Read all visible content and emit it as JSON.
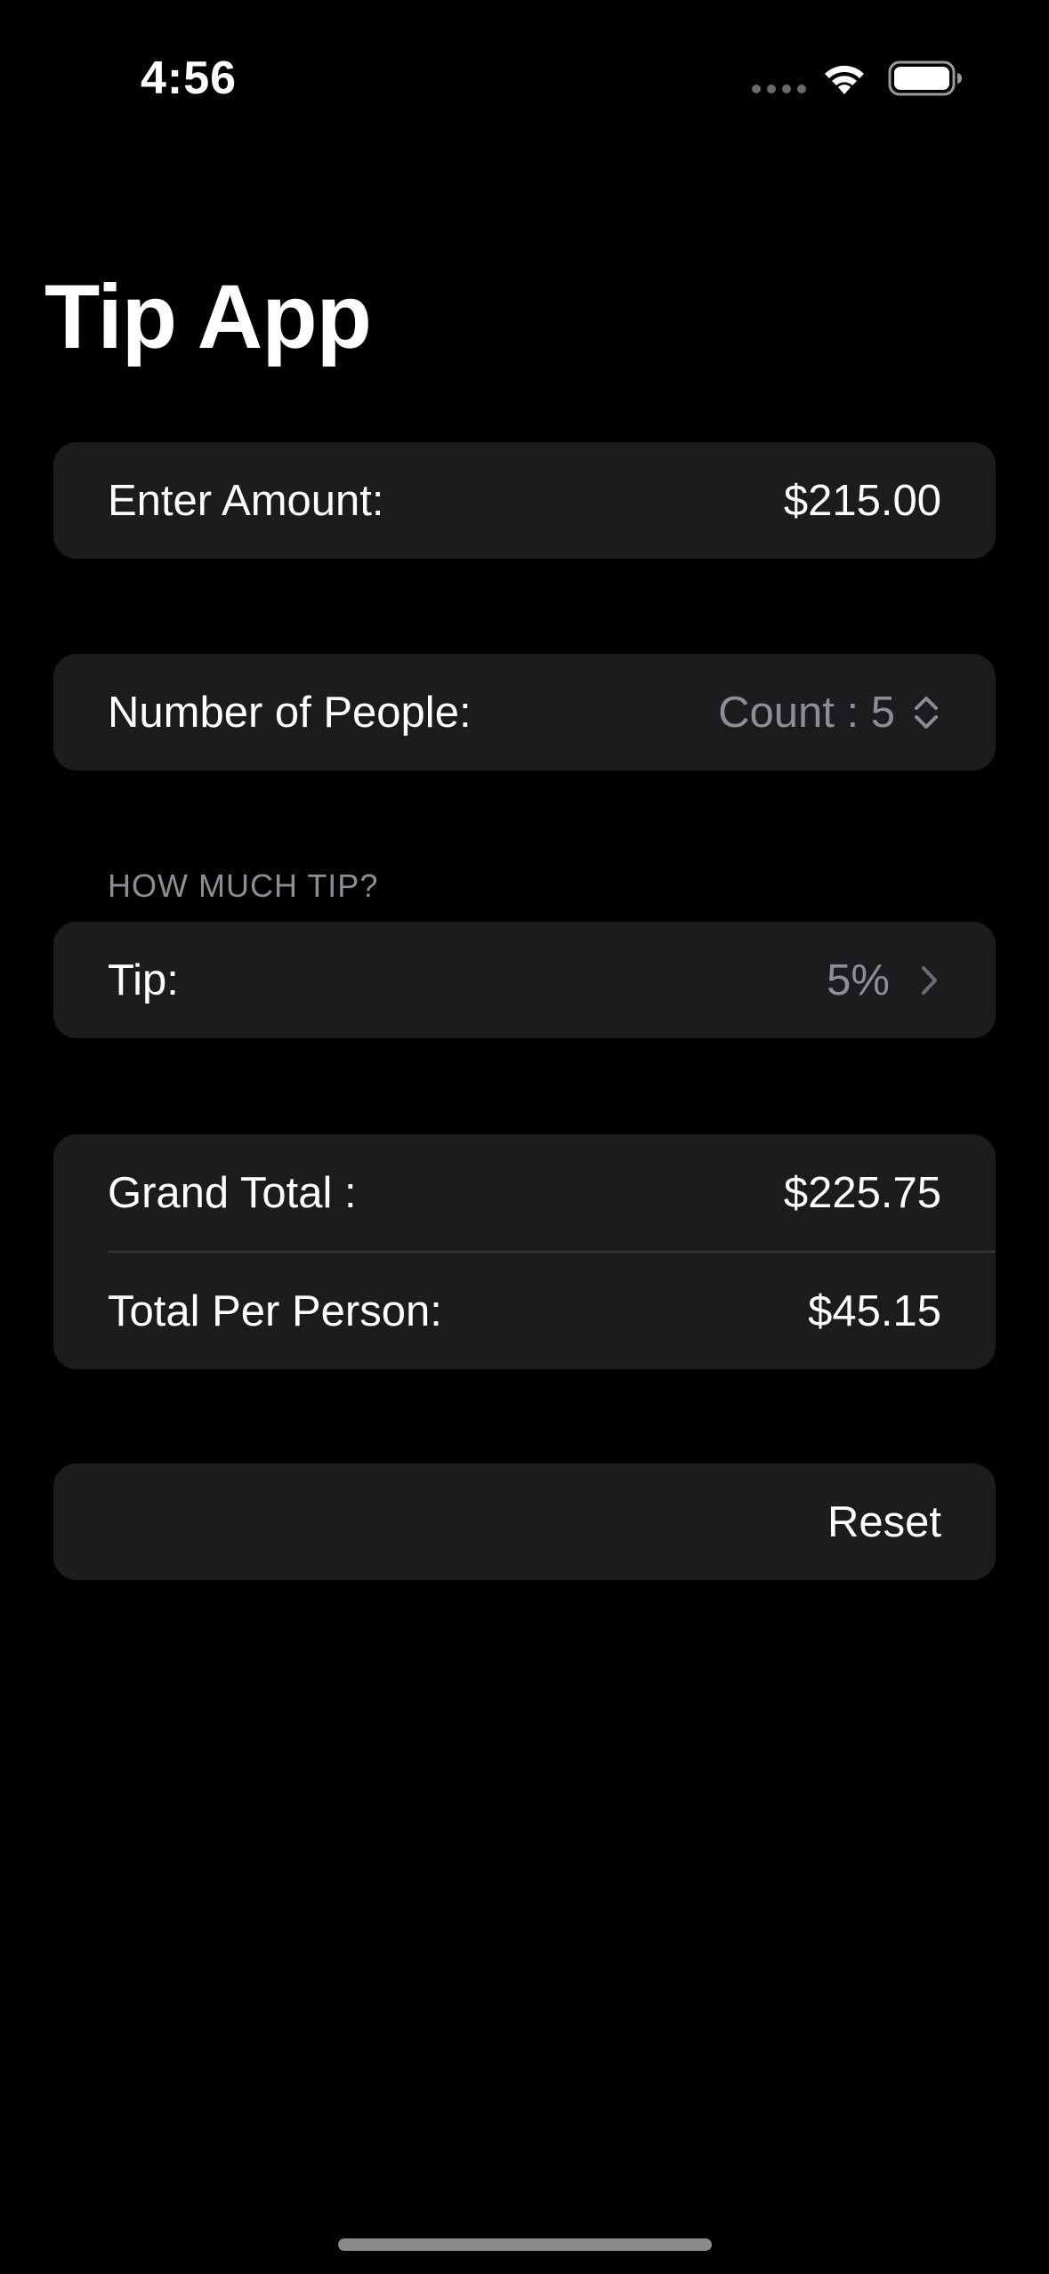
{
  "status_bar": {
    "time": "4:56"
  },
  "title": "Tip App",
  "amount_row": {
    "label": "Enter Amount:",
    "value": "$215.00"
  },
  "people_row": {
    "label": "Number of People:",
    "value": "Count : 5"
  },
  "tip_section": {
    "header": "HOW MUCH TIP?",
    "label": "Tip:",
    "value": "5%"
  },
  "totals": {
    "grand_total_label": "Grand Total :",
    "grand_total_value": "$225.75",
    "per_person_label": "Total Per Person:",
    "per_person_value": "$45.15"
  },
  "reset_label": "Reset",
  "icons": {
    "wifi": "wifi-icon",
    "battery": "battery-icon",
    "stepper": "chevron-up-down-icon",
    "disclosure": "chevron-right-icon"
  },
  "colors": {
    "background": "#000000",
    "card": "#1c1c1e",
    "secondary_text": "#8d8d93"
  }
}
